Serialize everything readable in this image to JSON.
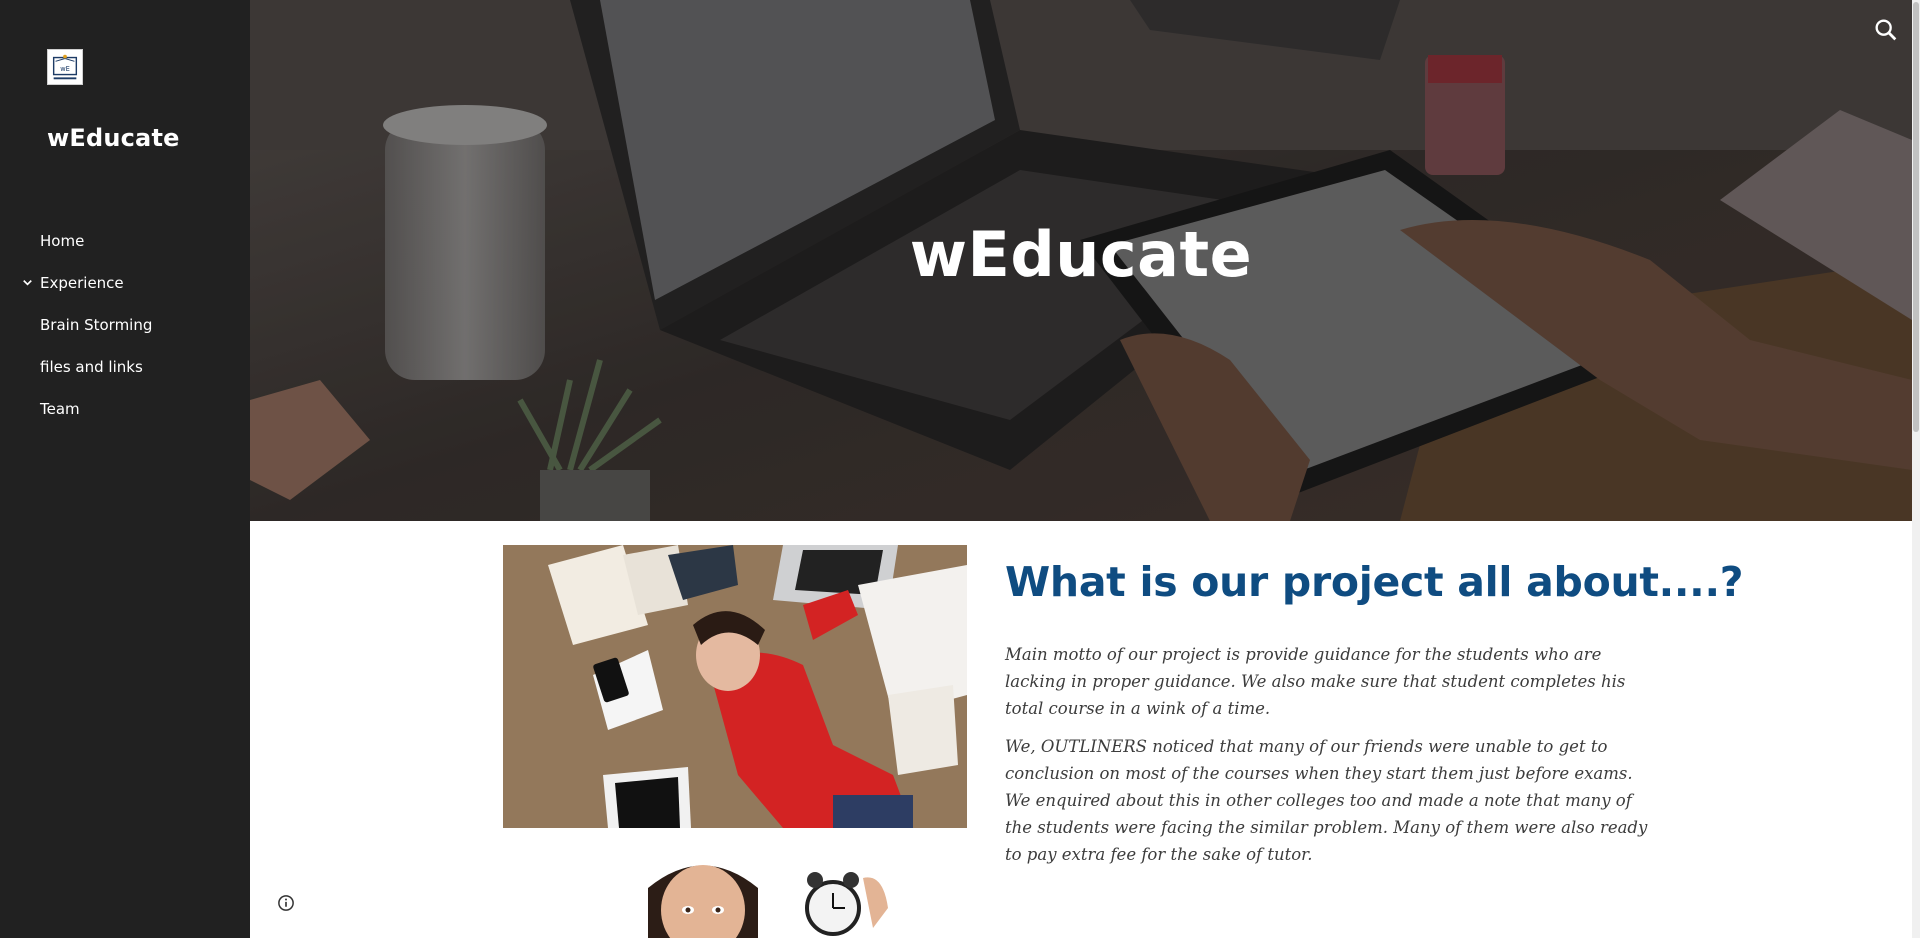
{
  "sidebar": {
    "logo_label": "wEducate logo",
    "logo_text": "wE",
    "site_title": "wEducate",
    "nav_items": [
      {
        "label": "Home",
        "has_children": false
      },
      {
        "label": "Experience",
        "has_children": true
      },
      {
        "label": "Brain Storming",
        "has_children": false
      },
      {
        "label": "files and links",
        "has_children": false
      },
      {
        "label": "Team",
        "has_children": false
      }
    ]
  },
  "header": {
    "hero_title": "wEducate",
    "search_icon": "search-icon"
  },
  "main": {
    "heading": "What is our project all about....?",
    "paragraphs": [
      "Main motto of our project is provide guidance for the students who are lacking in proper guidance. We also make sure that student completes his total course in a wink of a time.",
      "We, OUTLINERS noticed that many of our friends were unable to get to conclusion on most of the courses when they start them just before exams. We enquired about this in other colleges too and made a note that many of the students were facing the similar problem. Many of them were also ready to pay extra fee for the sake of tutor."
    ],
    "images": [
      "student-stressed-photo",
      "student-alarm-clock-photo"
    ]
  },
  "footer": {
    "info_icon": "info-icon"
  },
  "colors": {
    "sidebar_bg": "#212121",
    "heading": "#0f4c81",
    "body_text": "#3c3c3c"
  }
}
